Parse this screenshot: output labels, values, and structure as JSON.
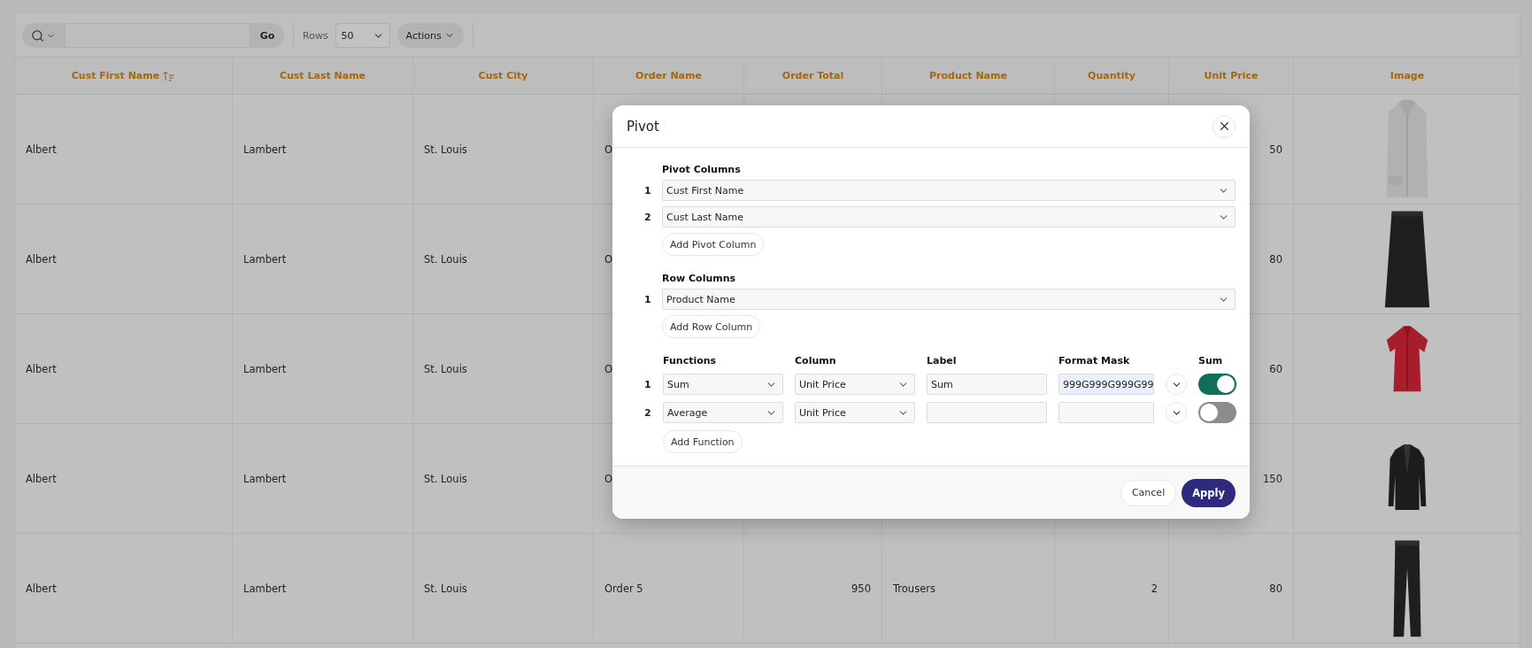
{
  "toolbar": {
    "go_button": "Go",
    "rows_label": "Rows",
    "rows_value": "50",
    "actions_button": "Actions"
  },
  "table": {
    "columns": [
      {
        "label": "Cust First Name",
        "sorted": true
      },
      {
        "label": "Cust Last Name",
        "sorted": false
      },
      {
        "label": "Cust City",
        "sorted": false
      },
      {
        "label": "Order Name",
        "sorted": false
      },
      {
        "label": "Order Total",
        "sorted": false
      },
      {
        "label": "Product Name",
        "sorted": false
      },
      {
        "label": "Quantity",
        "sorted": false
      },
      {
        "label": "Unit Price",
        "sorted": false
      },
      {
        "label": "Image",
        "sorted": false
      }
    ],
    "rows": [
      {
        "cells": [
          "Albert",
          "Lambert",
          "St. Louis",
          "O",
          null,
          null,
          null,
          "50"
        ],
        "image": {
          "kind": "picture"
        }
      },
      {
        "cells": [
          "Albert",
          "Lambert",
          "St. Louis",
          "O",
          null,
          null,
          null,
          "80"
        ],
        "image": {
          "kind": "picture"
        }
      },
      {
        "cells": [
          "Albert",
          "Lambert",
          "St. Louis",
          "O",
          null,
          null,
          null,
          "60"
        ],
        "image": {
          "kind": "picture"
        }
      },
      {
        "cells": [
          "Albert",
          "Lambert",
          "St. Louis",
          "O",
          null,
          null,
          null,
          "150"
        ],
        "image": {
          "kind": "picture"
        }
      },
      {
        "cells": [
          "Albert",
          "Lambert",
          "St. Louis",
          "Order 5",
          "950",
          "Trousers",
          "2",
          "80"
        ],
        "image": {
          "kind": "picture"
        }
      }
    ]
  },
  "dialog": {
    "title": "Pivot",
    "pivot_columns": {
      "heading": "Pivot Columns",
      "items": [
        {
          "number": "1",
          "value": "Cust First Name"
        },
        {
          "number": "2",
          "value": "Cust Last Name"
        }
      ],
      "add_button": "Add Pivot Column"
    },
    "row_columns": {
      "heading": "Row Columns",
      "items": [
        {
          "number": "1",
          "value": "Product Name"
        }
      ],
      "add_button": "Add Row Column"
    },
    "functions": {
      "headings": [
        "Functions",
        "Column",
        "Label",
        "Format Mask",
        "Sum"
      ],
      "rows": [
        {
          "number": "1",
          "function": "Sum",
          "column": "Unit Price",
          "label": "Sum",
          "format_mask": "999G999G999G99",
          "focused": true,
          "sum": true
        },
        {
          "number": "2",
          "function": "Average",
          "column": "Unit Price",
          "focused": false,
          "sum": false
        }
      ],
      "add_button": "Add Function"
    },
    "cancel_button": "Cancel",
    "apply_button": "Apply"
  }
}
